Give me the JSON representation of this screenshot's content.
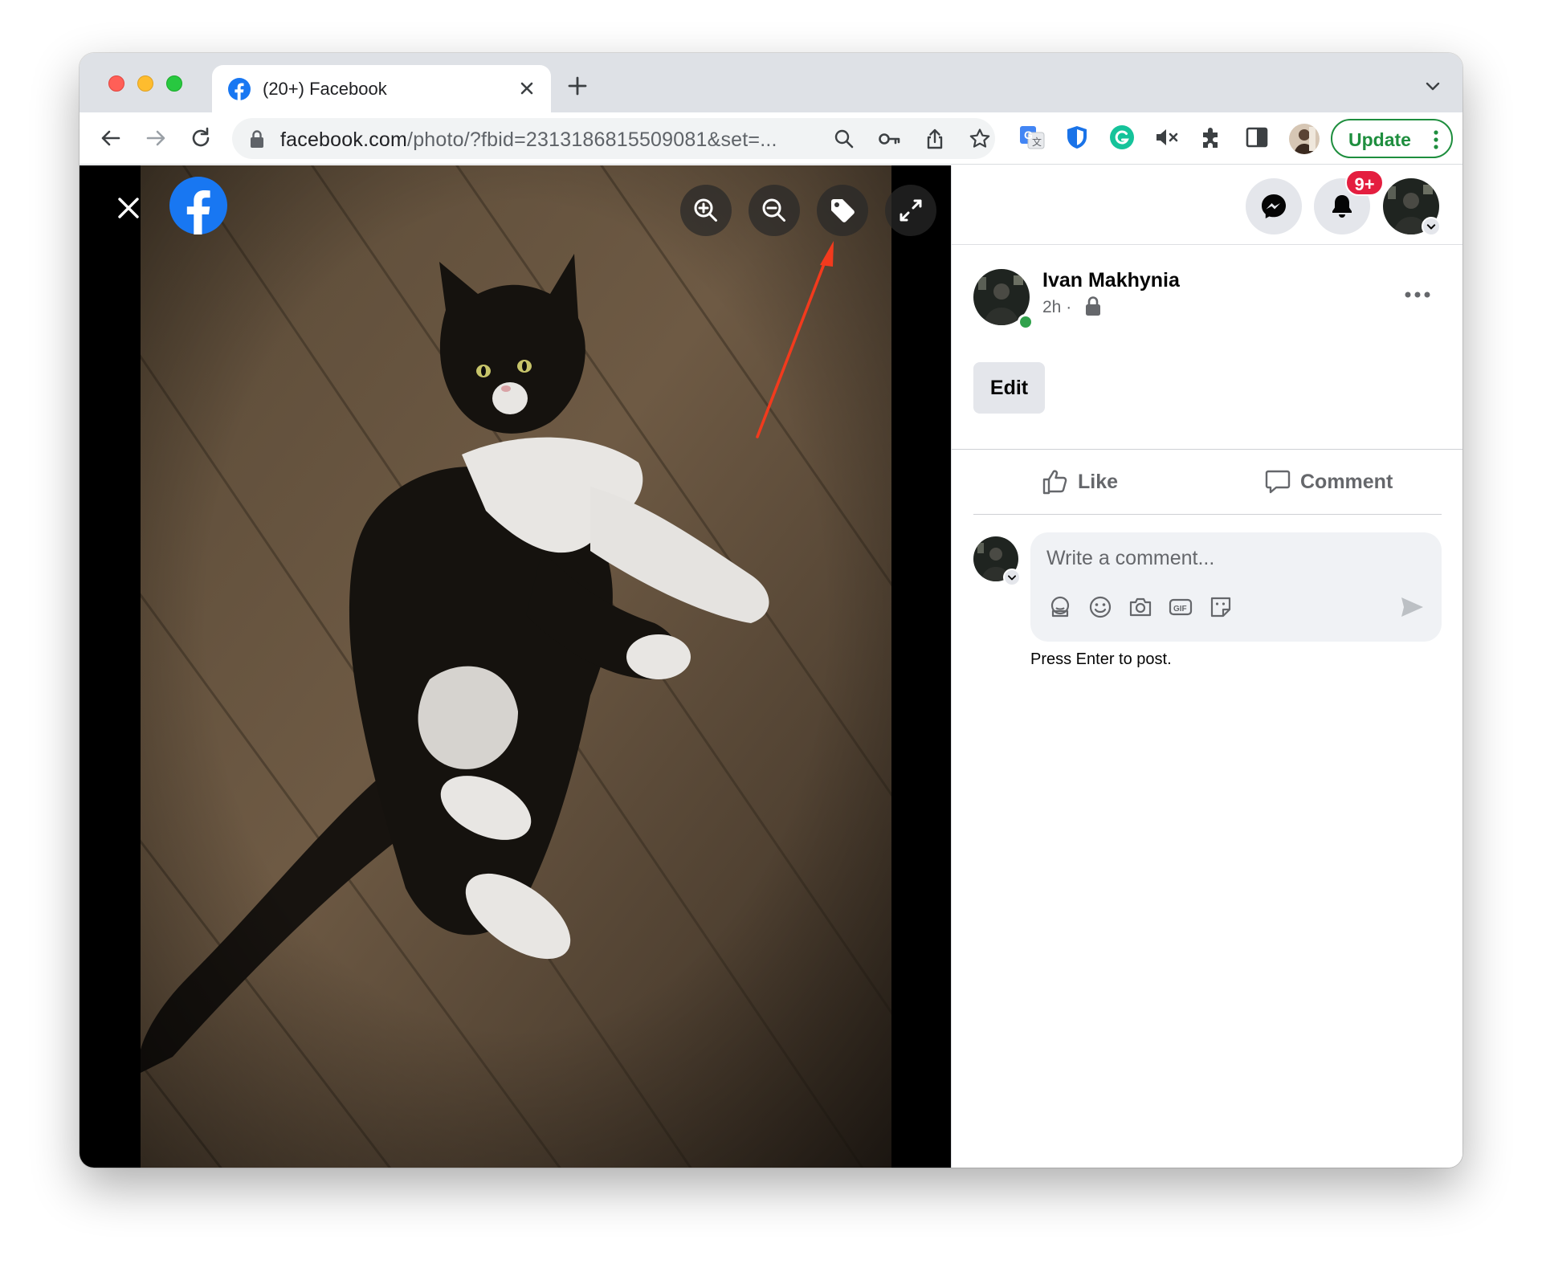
{
  "browser": {
    "tab": {
      "title": "(20+) Facebook"
    },
    "address": {
      "host": "facebook.com",
      "path": "/photo/?fbid=2313186815509081&set=..."
    },
    "update_button": {
      "label": "Update"
    }
  },
  "colors": {
    "facebook_blue": "#1877f2",
    "update_green": "#1e8e3e",
    "badge_red": "#e41e3f",
    "annotation_red": "#f23a1d"
  },
  "viewer": {
    "icons": [
      "close-icon",
      "facebook-logo",
      "zoom-in-icon",
      "zoom-out-icon",
      "tag-icon",
      "fullscreen-icon"
    ]
  },
  "nav": {
    "notification_badge": "9+"
  },
  "post": {
    "author": "Ivan Makhynia",
    "time": "2h",
    "dot": "·",
    "edit_label": "Edit",
    "like_label": "Like",
    "comment_label": "Comment"
  },
  "composer": {
    "placeholder": "Write a comment...",
    "hint": "Press Enter to post."
  }
}
